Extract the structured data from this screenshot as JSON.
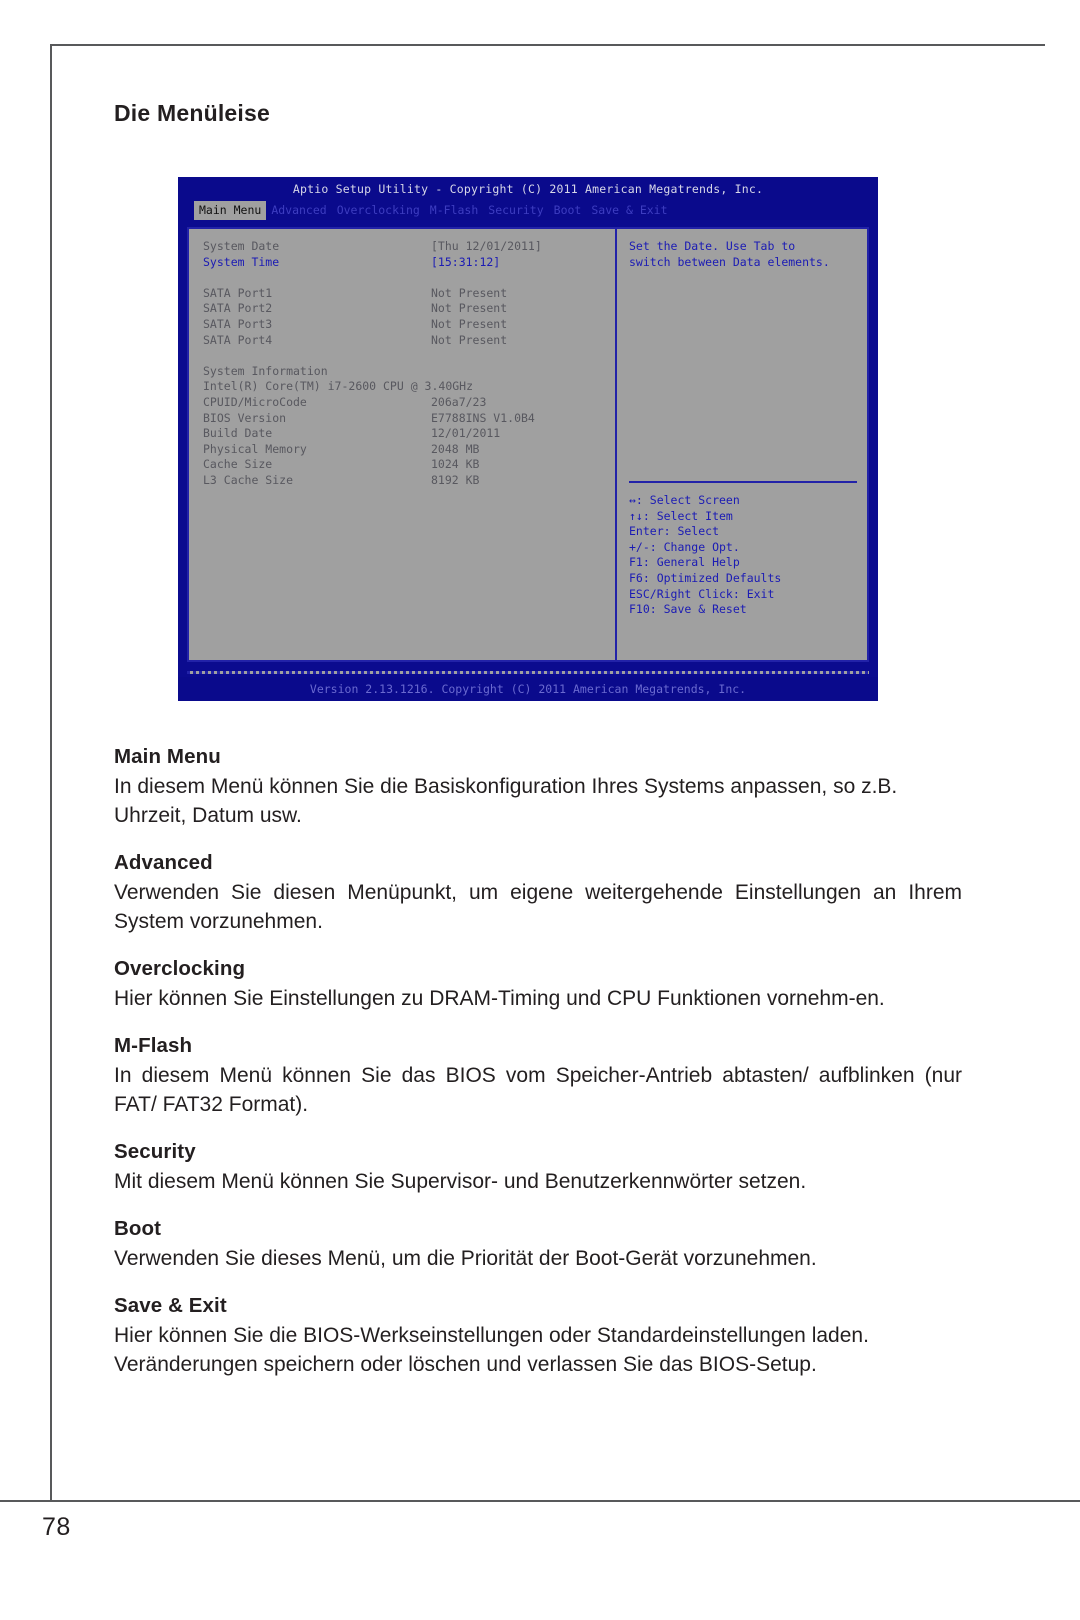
{
  "page": {
    "title": "Die Menüleise",
    "number": "78"
  },
  "bios": {
    "title": "Aptio Setup Utility - Copyright (C) 2011 American Megatrends, Inc.",
    "tabs": [
      {
        "label": "Main Menu",
        "active": true
      },
      {
        "label": "Advanced",
        "active": false
      },
      {
        "label": "Overclocking",
        "active": false
      },
      {
        "label": "M-Flash",
        "active": false
      },
      {
        "label": "Security",
        "active": false
      },
      {
        "label": "Boot",
        "active": false
      },
      {
        "label": "Save & Exit",
        "active": false
      }
    ],
    "settings": [
      {
        "label": "System Date",
        "value": "[Thu 12/01/2011]",
        "selected": false
      },
      {
        "label": "System Time",
        "value": "[15:31:12]",
        "selected": true
      },
      {
        "label": "",
        "value": "",
        "spacer": true
      },
      {
        "label": "SATA Port1",
        "value": "Not Present",
        "selected": false
      },
      {
        "label": "SATA Port2",
        "value": "Not Present",
        "selected": false
      },
      {
        "label": "SATA Port3",
        "value": "Not Present",
        "selected": false
      },
      {
        "label": "SATA Port4",
        "value": "Not Present",
        "selected": false
      },
      {
        "label": "",
        "value": "",
        "spacer": true
      },
      {
        "label": "System Information",
        "value": "",
        "selected": false
      },
      {
        "label": "Intel(R) Core(TM) i7-2600 CPU @ 3.40GHz",
        "value": "",
        "selected": false
      },
      {
        "label": "CPUID/MicroCode",
        "value": "206a7/23",
        "selected": false
      },
      {
        "label": "BIOS Version",
        "value": "E7788INS V1.0B4",
        "selected": false
      },
      {
        "label": "Build Date",
        "value": "12/01/2011",
        "selected": false
      },
      {
        "label": "Physical Memory",
        "value": "2048 MB",
        "selected": false
      },
      {
        "label": "Cache Size",
        "value": "1024 KB",
        "selected": false
      },
      {
        "label": "L3 Cache Size",
        "value": "8192 KB",
        "selected": false
      }
    ],
    "help": {
      "description_line1": "Set the Date. Use Tab to",
      "description_line2": "switch between Data elements.",
      "keys": [
        "↔: Select Screen",
        "↑↓: Select Item",
        "Enter: Select",
        "+/-: Change Opt.",
        "F1: General Help",
        "F6: Optimized Defaults",
        "ESC/Right Click: Exit",
        "F10: Save & Reset"
      ]
    },
    "footer": "Version 2.13.1216. Copyright (C) 2011 American Megatrends, Inc."
  },
  "sections": [
    {
      "heading": "Main Menu",
      "body": "In diesem Menü können Sie die Basiskonfiguration Ihres Systems anpassen, so z.B. Uhrzeit, Datum usw."
    },
    {
      "heading": "Advanced",
      "body": "Verwenden Sie diesen Menüpunkt, um eigene weitergehende Einstellungen an Ihrem System vorzunehmen."
    },
    {
      "heading": "Overclocking",
      "body": "Hier können Sie Einstellungen zu DRAM-Timing und CPU Funktionen vornehm-en."
    },
    {
      "heading": "M-Flash",
      "body": "In diesem Menü können Sie das BIOS vom Speicher-Antrieb abtasten/ aufblinken (nur FAT/ FAT32 Format)."
    },
    {
      "heading": "Security",
      "body": "Mit diesem Menü können Sie Supervisor- und Benutzerkennwörter setzen."
    },
    {
      "heading": "Boot",
      "body": "Verwenden Sie dieses Menü, um die Priorität der Boot-Gerät vorzunehmen."
    },
    {
      "heading": "Save & Exit",
      "body": "Hier können Sie die BIOS-Werkseinstellungen oder Standardeinstellungen laden. Veränderungen speichern oder löschen und verlassen Sie das BIOS-Setup."
    }
  ],
  "colors": {
    "bios_blue": "#0a0a8c",
    "bios_gray": "#a0a0a0",
    "bios_border_blue": "#2222a8",
    "rule_gray": "#58595b"
  }
}
